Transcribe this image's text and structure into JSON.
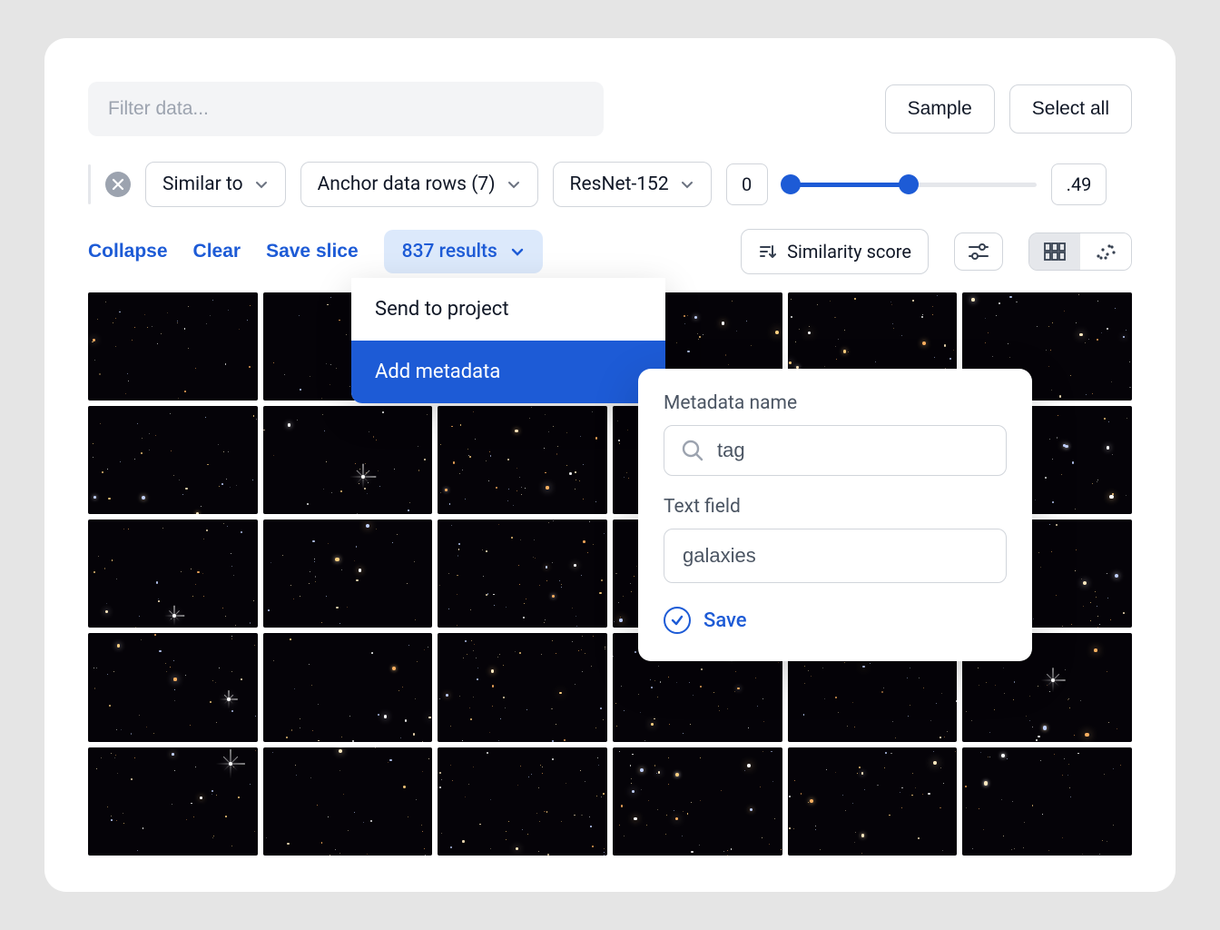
{
  "header": {
    "filter_placeholder": "Filter data...",
    "sample_label": "Sample",
    "select_all_label": "Select all"
  },
  "filters": {
    "similar_to_label": "Similar to",
    "anchor_label": "Anchor data rows (7)",
    "model_label": "ResNet-152",
    "range_min": "0",
    "range_max": ".49"
  },
  "actions": {
    "collapse_label": "Collapse",
    "clear_label": "Clear",
    "save_slice_label": "Save slice",
    "results_label": "837 results",
    "sort_label": "Similarity score"
  },
  "dropdown": {
    "items": [
      {
        "label": "Send to project",
        "active": false
      },
      {
        "label": "Add metadata",
        "active": true
      }
    ]
  },
  "metadata_panel": {
    "name_label": "Metadata name",
    "name_value": "tag",
    "text_label": "Text field",
    "text_value": "galaxies",
    "save_label": "Save"
  },
  "grid": {
    "thumb_count": 30
  }
}
